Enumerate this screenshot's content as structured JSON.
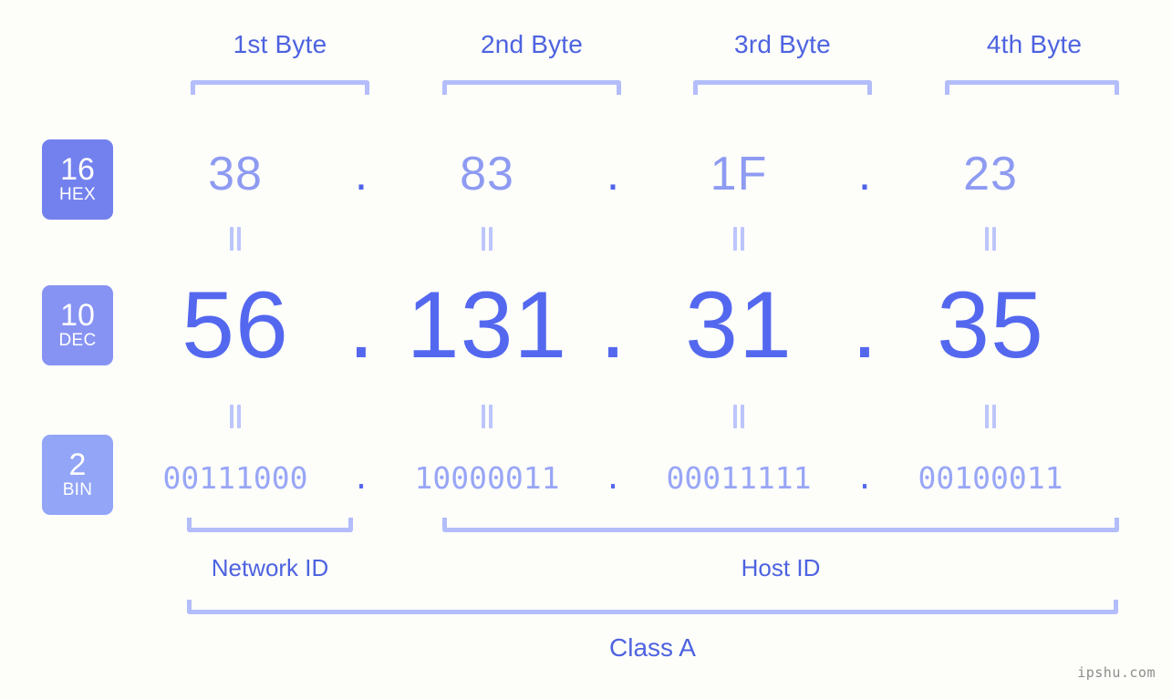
{
  "background_color": "#fdfdfa",
  "accent_colors": {
    "label_blue": "#4d63e0",
    "bracket_blue": "#b3bdfb",
    "hex_value_blue": "#8e9bf2",
    "dec_value_blue": "#5468ef",
    "bin_value_blue": "#98a6f6",
    "dot_blue": "#4f62e8",
    "badge_hex": "#7381ee",
    "badge_dec": "#8793f3",
    "badge_bin": "#92a5f6",
    "watermark_gray": "#8c8c8c"
  },
  "byte_headers": [
    {
      "label": "1st Byte"
    },
    {
      "label": "2nd Byte"
    },
    {
      "label": "3rd Byte"
    },
    {
      "label": "4th Byte"
    }
  ],
  "bases": [
    {
      "number": "16",
      "name": "HEX"
    },
    {
      "number": "10",
      "name": "DEC"
    },
    {
      "number": "2",
      "name": "BIN"
    }
  ],
  "separator": ".",
  "equals_glyph": "=",
  "rows": {
    "hex": {
      "base_number": "16",
      "base_name": "HEX",
      "values": [
        "38",
        "83",
        "1F",
        "23"
      ]
    },
    "dec": {
      "base_number": "10",
      "base_name": "DEC",
      "values": [
        "56",
        "131",
        "31",
        "35"
      ]
    },
    "bin": {
      "base_number": "2",
      "base_name": "BIN",
      "values": [
        "00111000",
        "10000011",
        "00011111",
        "00100011"
      ]
    }
  },
  "ip_address": {
    "dec": "56.131.31.35",
    "hex": "38.83.1F.23",
    "bin": "00111000.10000011.00011111.00100011"
  },
  "segments": {
    "network_id": {
      "label": "Network ID",
      "bytes": 1
    },
    "host_id": {
      "label": "Host ID",
      "bytes": 3
    },
    "class": {
      "label": "Class A"
    }
  },
  "watermark": "ipshu.com"
}
